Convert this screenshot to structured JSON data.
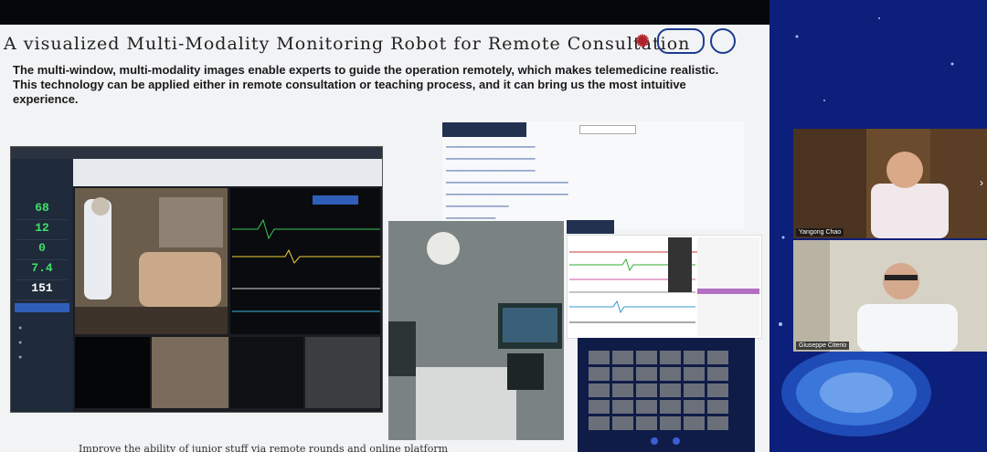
{
  "slide": {
    "title": "A visualized Multi-Modality Monitoring Robot for Remote Consultation",
    "description": "The multi-window, multi-modality images enable experts to guide the operation remotely, which makes telemedicine realistic. This technology can be applied either in remote consultation or teaching process, and it can bring us the most intuitive experience.",
    "caption": "Improve the ability of junior stuff via remote rounds and online platform"
  },
  "monitor": {
    "vitals": [
      "68",
      "12",
      "0",
      "7.4",
      "151"
    ]
  },
  "participants": [
    {
      "name": "Yangong Chao"
    },
    {
      "name": "Giuseppe Citerio"
    }
  ],
  "colors": {
    "slide_bg": "#f2f3f5",
    "side_bg": "#0c1f7a",
    "nav_dark": "#22314f",
    "vital_green": "#3fe06b"
  }
}
